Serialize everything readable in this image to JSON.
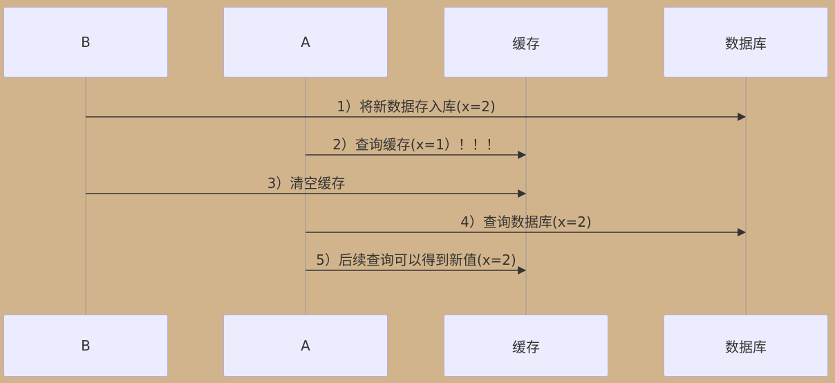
{
  "participants": [
    {
      "id": "b",
      "label": "B"
    },
    {
      "id": "a",
      "label": "A"
    },
    {
      "id": "cache",
      "label": "缓存"
    },
    {
      "id": "db",
      "label": "数据库"
    }
  ],
  "messages": [
    {
      "from": "b",
      "to": "db",
      "label": "1）将新数据存入库(x=2)"
    },
    {
      "from": "a",
      "to": "cache",
      "label": "2）查询缓存(x=1）！！！"
    },
    {
      "from": "b",
      "to": "cache",
      "label": "3）清空缓存"
    },
    {
      "from": "a",
      "to": "db",
      "label": "4）查询数据库(x=2)"
    },
    {
      "from": "a",
      "to": "cache",
      "label": "5）后续查询可以得到新值(x=2)"
    }
  ]
}
